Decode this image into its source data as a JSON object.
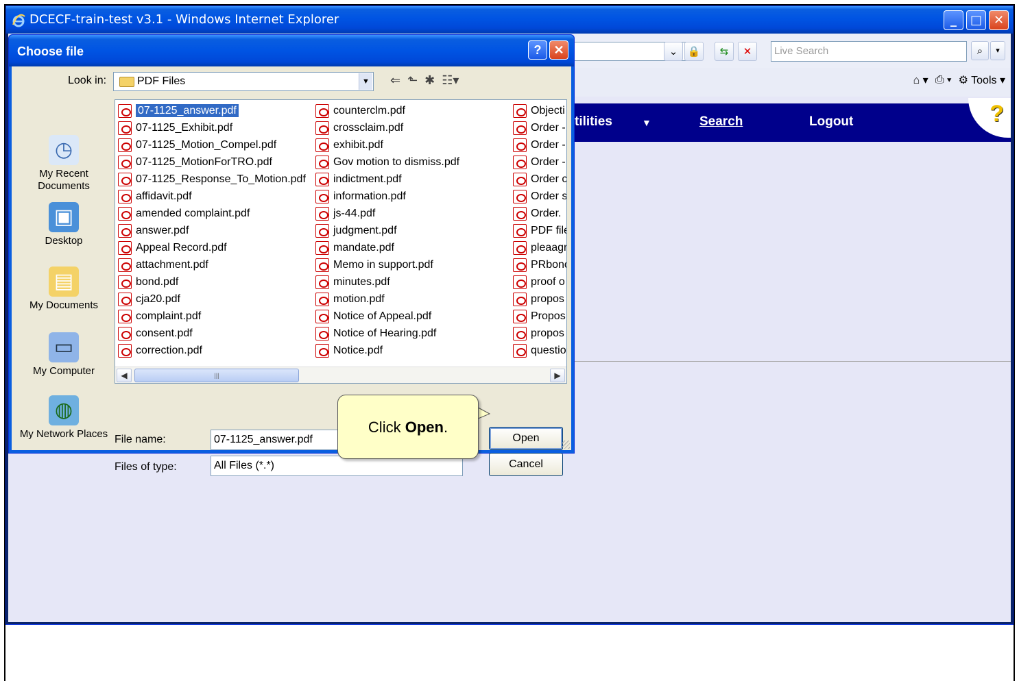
{
  "window": {
    "title": "DCECF-train-test v3.1 - Windows Internet Explorer",
    "controls": [
      "minimize",
      "maximize",
      "close"
    ]
  },
  "toolbar": {
    "search_placeholder": "Live Search",
    "tools_label": "Tools"
  },
  "site_nav": {
    "items": [
      "tilities",
      "Search",
      "Logout"
    ]
  },
  "dialog": {
    "title": "Choose file",
    "help_button": "?",
    "look_in_label": "Look in:",
    "look_in_value": "PDF Files",
    "places": [
      {
        "label": "My Recent Documents",
        "icon": "recent-documents-icon"
      },
      {
        "label": "Desktop",
        "icon": "desktop-icon"
      },
      {
        "label": "My Documents",
        "icon": "my-documents-icon"
      },
      {
        "label": "My Computer",
        "icon": "my-computer-icon"
      },
      {
        "label": "My Network Places",
        "icon": "network-places-icon"
      }
    ],
    "files_col1": [
      "07-1125_answer.pdf",
      "07-1125_Exhibit.pdf",
      "07-1125_Motion_Compel.pdf",
      "07-1125_MotionForTRO.pdf",
      "07-1125_Response_To_Motion.pdf",
      "affidavit.pdf",
      "amended complaint.pdf",
      "answer.pdf",
      "Appeal Record.pdf",
      "attachment.pdf",
      "bond.pdf",
      "cja20.pdf",
      "complaint.pdf",
      "consent.pdf",
      "correction.pdf"
    ],
    "files_col2": [
      "counterclm.pdf",
      "crossclaim.pdf",
      "exhibit.pdf",
      "Gov motion to dismiss.pdf",
      "indictment.pdf",
      "information.pdf",
      "js-44.pdf",
      "judgment.pdf",
      "mandate.pdf",
      "Memo in support.pdf",
      "minutes.pdf",
      "motion.pdf",
      "Notice of Appeal.pdf",
      "Notice of Hearing.pdf",
      "Notice.pdf"
    ],
    "files_col3": [
      "Objecti",
      "Order -",
      "Order -",
      "Order -",
      "Order c",
      "Order s",
      "Order.",
      "PDF file",
      "pleaagr",
      "PRbonc",
      "proof o",
      "propos",
      "Propos",
      "propos",
      "questio"
    ],
    "selected_file": "07-1125_answer.pdf",
    "file_name_label": "File name:",
    "file_name_value": "07-1125_answer.pdf",
    "files_of_type_label": "Files of type:",
    "files_of_type_value": "All Files (*.*)",
    "open_button": "Open",
    "cancel_button": "Cancel"
  },
  "callout": {
    "prefix": "Click ",
    "bold": "Open",
    "suffix": "."
  },
  "colors": {
    "titlebar": "#0054e3",
    "nav_bar": "#00008b",
    "content_bg": "#e6e7f7",
    "callout_bg": "#ffffc8",
    "selection": "#316ac5"
  }
}
